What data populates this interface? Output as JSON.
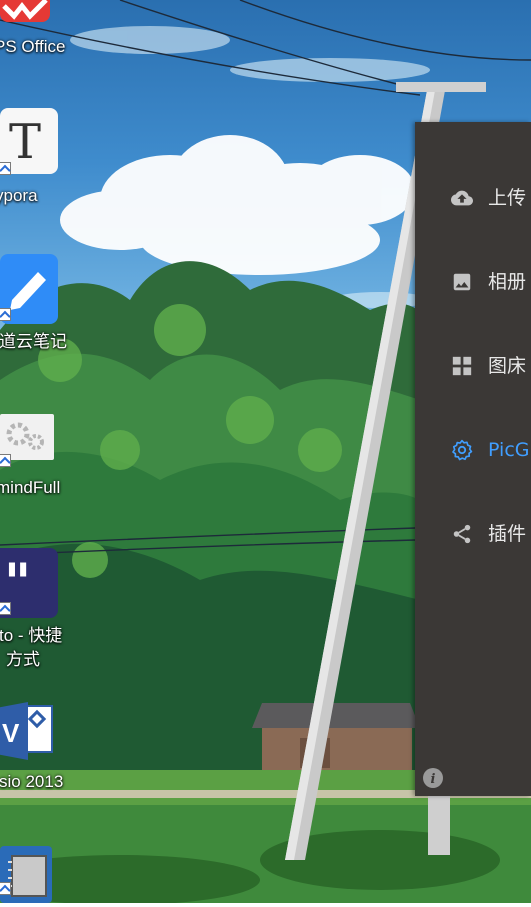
{
  "desktop": {
    "icons": [
      {
        "label": "PS Office",
        "icon": "wps-office-icon"
      },
      {
        "label": "ypora",
        "icon": "typora-icon"
      },
      {
        "label": "道云笔记",
        "icon": "youdao-note-icon"
      },
      {
        "label": "mindFull",
        "icon": "mindfull-icon"
      },
      {
        "label": "to - 快捷",
        "label2": "方式",
        "icon": "quote-app-icon"
      },
      {
        "label": "sio 2013",
        "icon": "visio-icon"
      },
      {
        "label": "",
        "icon": "chip-icon"
      }
    ]
  },
  "app": {
    "name": "PicGo",
    "menu": [
      {
        "label": "上传",
        "icon": "upload-cloud-icon",
        "active": false
      },
      {
        "label": "相册",
        "icon": "image-icon",
        "active": false
      },
      {
        "label": "图床",
        "icon": "grid-icon",
        "active": false
      },
      {
        "label": "PicG",
        "icon": "gear-icon",
        "active": true
      },
      {
        "label": "插件",
        "icon": "share-icon",
        "active": false
      }
    ],
    "accent_color": "#409eff",
    "panel_color": "#3b3836"
  }
}
